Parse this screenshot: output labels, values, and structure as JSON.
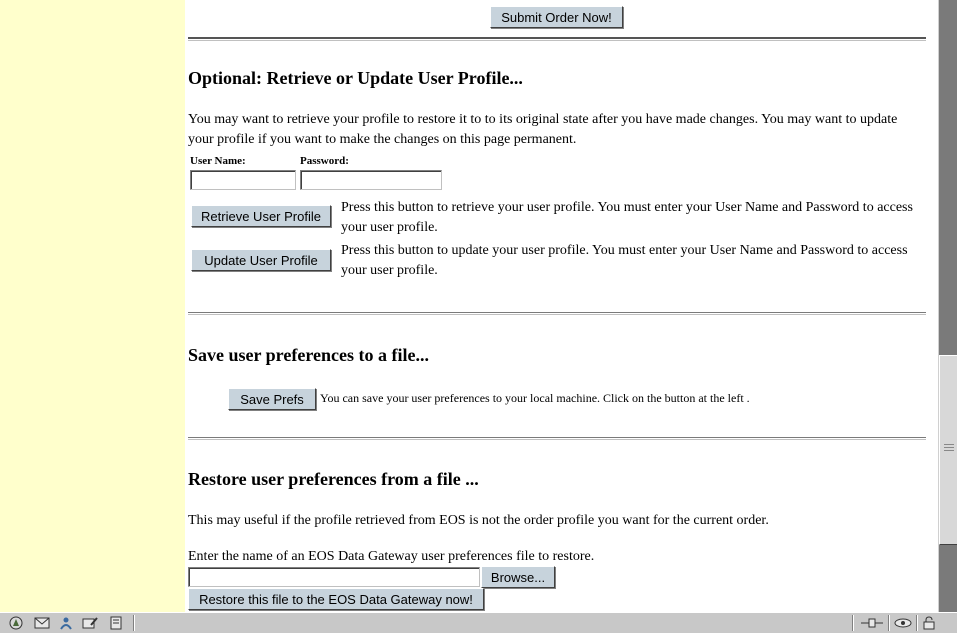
{
  "submit": {
    "label": "Submit Order Now!"
  },
  "profile": {
    "heading": "Optional: Retrieve or Update User Profile...",
    "intro": "You may want to retrieve your profile to restore it to to its original state after you have made changes. You may want to update your profile if you want to make the changes on this page permanent.",
    "username_label": "User Name:",
    "password_label": "Password:",
    "username_value": "",
    "password_value": "",
    "retrieve_label": "Retrieve User Profile",
    "retrieve_desc": "Press this button to retrieve your user profile. You must enter your User Name and Password to access your user profile.",
    "update_label": "Update User Profile",
    "update_desc": "Press this button to update your user profile. You must enter your User Name and Password to access your user profile."
  },
  "save": {
    "heading": "Save user preferences to a file...",
    "button_label": "Save Prefs",
    "desc": "You can save your user preferences to your local machine. Click on the button at the left ."
  },
  "restore": {
    "heading": "Restore user preferences from a file ...",
    "note": "This may useful if the profile retrieved from EOS is not the order profile you want for the current order.",
    "prompt": "Enter the name of an EOS Data Gateway user preferences file to restore.",
    "file_value": "",
    "browse_label": "Browse...",
    "submit_label": "Restore this file to the EOS Data Gateway now!"
  },
  "statusbar": {
    "icons": [
      "navigator-icon",
      "mail-icon",
      "people-icon",
      "composer-icon",
      "bookmark-icon",
      "connection-icon",
      "security-icon",
      "lock-icon"
    ]
  },
  "colors": {
    "sidebar": "#ffffcc",
    "button": "#c7d3dc"
  }
}
